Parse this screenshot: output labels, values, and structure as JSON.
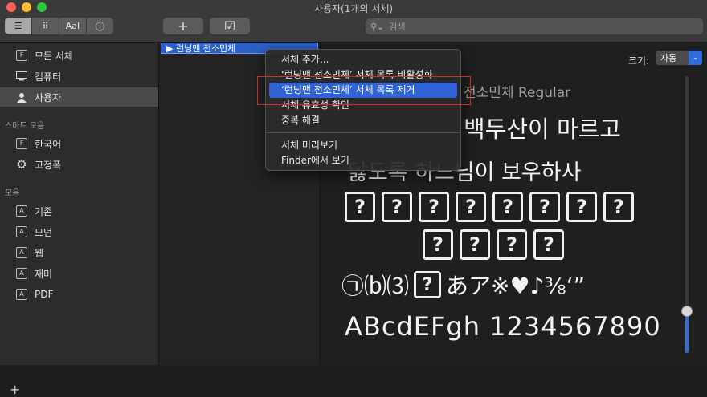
{
  "window": {
    "title": "사용자(1개의 서체)"
  },
  "toolbar": {
    "view_buttons": [
      "list-view",
      "grid-view",
      "AaI",
      "info"
    ],
    "view_text": "AaI",
    "add_label": "+",
    "check_label": "☑",
    "search_placeholder": "검색"
  },
  "sidebar": {
    "library_items": [
      {
        "label": "모든 서체",
        "icon": "font-box-icon"
      },
      {
        "label": "컴퓨터",
        "icon": "monitor-icon"
      },
      {
        "label": "사용자",
        "icon": "user-icon",
        "selected": true
      }
    ],
    "smart_header": "스마트 모음",
    "smart_items": [
      {
        "label": "한국어",
        "icon": "font-box-icon"
      },
      {
        "label": "고정폭",
        "icon": "gear-icon"
      }
    ],
    "collections_header": "모음",
    "collection_items": [
      {
        "label": "기존",
        "icon": "collection-icon"
      },
      {
        "label": "모던",
        "icon": "collection-icon"
      },
      {
        "label": "웹",
        "icon": "collection-icon"
      },
      {
        "label": "재미",
        "icon": "collection-icon"
      },
      {
        "label": "PDF",
        "icon": "collection-icon"
      }
    ],
    "add_label": "+"
  },
  "font_list": {
    "selected_row": "▶ 런닝맨 전소민체"
  },
  "context_menu": {
    "items": [
      {
        "label": "서체 추가...",
        "highlighted": false
      },
      {
        "label": "‘런닝맨 전소민체’ 서체 목록 비활성화",
        "highlighted": false
      },
      {
        "label": "‘런닝맨 전소민체’ 서체 목록 제거",
        "highlighted": true
      },
      {
        "label": "서체 유효성 확인",
        "highlighted": false
      },
      {
        "label": "중복 해결",
        "highlighted": false
      },
      {
        "label": "서체 미리보기",
        "highlighted": false
      },
      {
        "label": "Finder에서 보기",
        "highlighted": false
      }
    ]
  },
  "preview": {
    "size_label": "크기:",
    "size_value": "자동",
    "font_name": "전소민체 Regular",
    "line1": "백두산이 마르고",
    "line2": "닳도록 하느님이 보우하사",
    "missing_glyph": "?",
    "line5_pre": "㉠⒝⑶",
    "line5_post": "あア※♥♪⅜‘”",
    "line6": "ABcdEFgh 1234567890",
    "slider_level": 0.15
  },
  "colors": {
    "accent": "#2f63d6",
    "highlight_outline": "#d42b2b"
  }
}
